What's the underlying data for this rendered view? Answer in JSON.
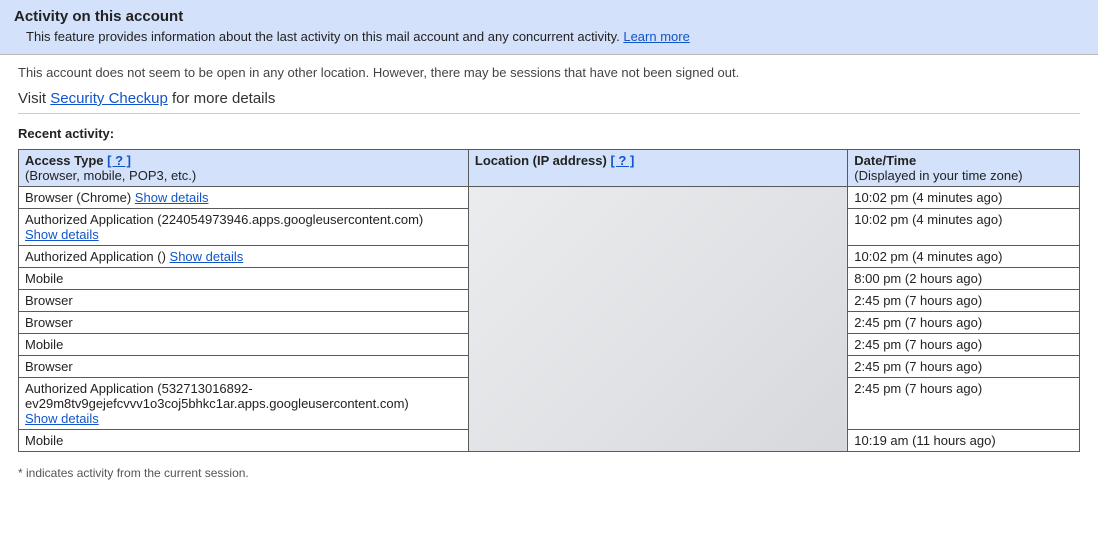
{
  "banner": {
    "title": "Activity on this account",
    "description": "This feature provides information about the last activity on this mail account and any concurrent activity. ",
    "learn_more": "Learn more"
  },
  "status_line": "This account does not seem to be open in any other location. However, there may be sessions that have not been signed out.",
  "visit": {
    "prefix": "Visit ",
    "link": "Security Checkup",
    "suffix": " for more details"
  },
  "recent_label": "Recent activity:",
  "columns": {
    "access": {
      "label": "Access Type ",
      "help": "[ ? ]",
      "sub": "(Browser, mobile, POP3, etc.)"
    },
    "location": {
      "label": "Location (IP address) ",
      "help": "[ ? ]"
    },
    "datetime": {
      "label": "Date/Time",
      "sub": "(Displayed in your time zone)"
    }
  },
  "rows": [
    {
      "access_text": "Browser (Chrome) ",
      "show_details": "Show details",
      "datetime": "10:02 pm (4 minutes ago)"
    },
    {
      "access_text": "Authorized Application (224054973946.apps.googleusercontent.com)",
      "show_details_newline": "Show details",
      "datetime": "10:02 pm (4 minutes ago)"
    },
    {
      "access_text": "Authorized Application () ",
      "show_details": "Show details",
      "datetime": "10:02 pm (4 minutes ago)"
    },
    {
      "access_text": "Mobile",
      "datetime": "8:00 pm (2 hours ago)"
    },
    {
      "access_text": "Browser",
      "datetime": "2:45 pm (7 hours ago)"
    },
    {
      "access_text": "Browser",
      "datetime": "2:45 pm (7 hours ago)"
    },
    {
      "access_text": "Mobile",
      "datetime": "2:45 pm (7 hours ago)"
    },
    {
      "access_text": "Browser",
      "datetime": "2:45 pm (7 hours ago)"
    },
    {
      "access_text": "Authorized Application (532713016892-ev29m8tv9gejefcvvv1o3coj5bhkc1ar.apps.googleusercontent.com)",
      "show_details_newline": "Show details",
      "datetime": "2:45 pm (7 hours ago)"
    },
    {
      "access_text": "Mobile",
      "datetime": "10:19 am (11 hours ago)"
    }
  ],
  "footnote": "* indicates activity from the current session."
}
